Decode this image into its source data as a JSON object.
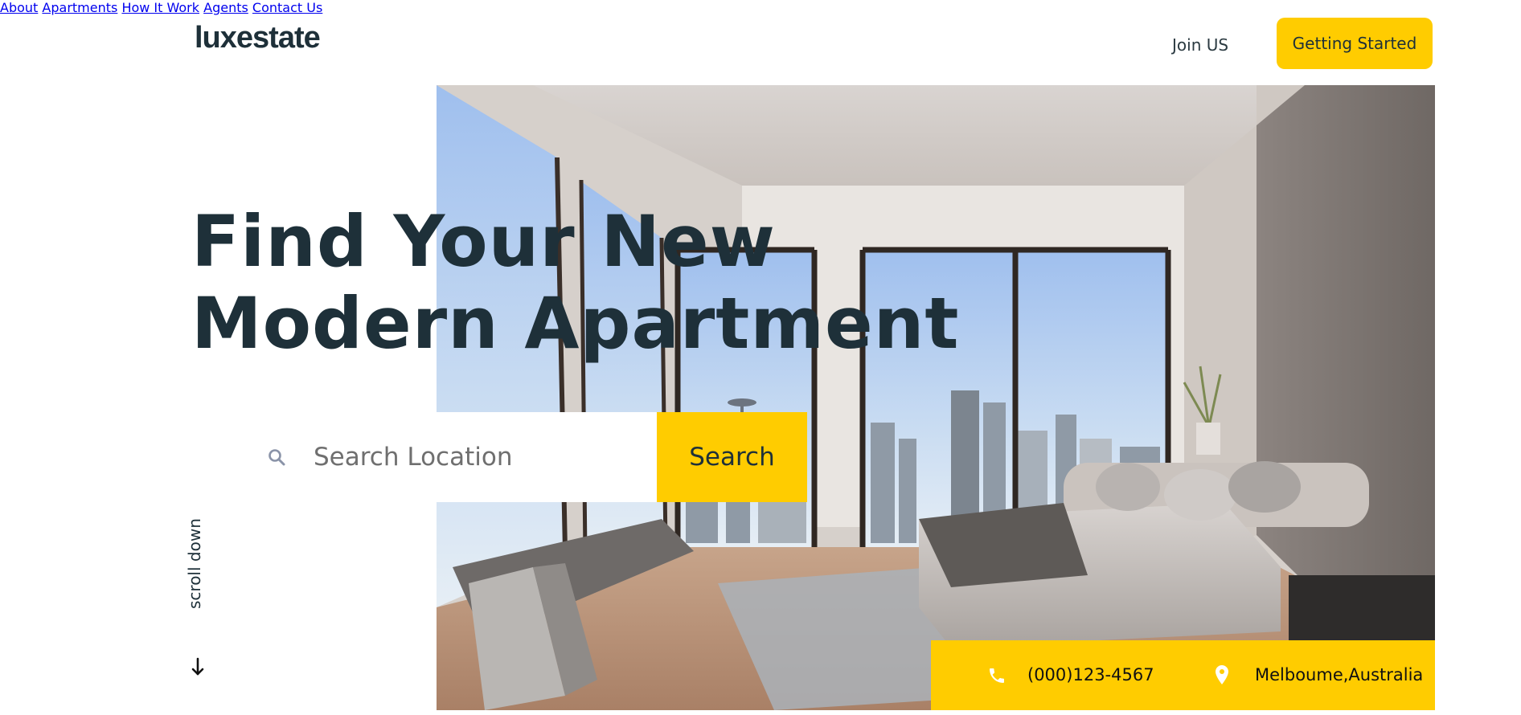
{
  "brand": {
    "logo_text": "luxestate"
  },
  "nav": {
    "items": [
      {
        "label": "About"
      },
      {
        "label": "Apartments"
      },
      {
        "label": "How It Work"
      },
      {
        "label": "Agents"
      },
      {
        "label": "Contact Us"
      }
    ],
    "join_label": "Join US",
    "cta_label": "Getting Started"
  },
  "hero": {
    "headline_line1": "Find Your New",
    "headline_line2": "Modern Apartment",
    "search": {
      "placeholder": "Search Location",
      "value": "",
      "button_label": "Search",
      "icon": "search-icon"
    },
    "scroll_label": "scroll down",
    "scroll_icon": "arrow-down-icon"
  },
  "contact": {
    "phone": "(000)123-4567",
    "phone_icon": "phone-icon",
    "location": "Melboume,Australia",
    "location_icon": "map-pin-icon"
  },
  "colors": {
    "accent": "#ffcc00",
    "text_dark": "#1e3039",
    "background": "#ffffff"
  }
}
